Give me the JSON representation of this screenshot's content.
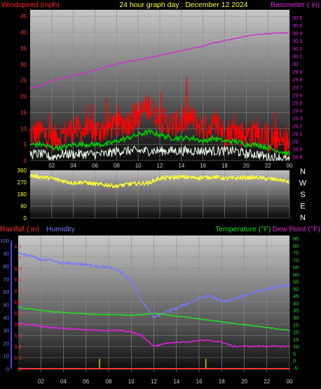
{
  "header": {
    "left_label": "Windspeed (mph)",
    "title": "24 hour graph day : December 12 2024",
    "right_label": "Barometer ( in)"
  },
  "colors": {
    "wind_speed": "#ff0000",
    "wind_avg": "#00cc00",
    "wind_low": "#f0fff0",
    "barometer": "#cc33cc",
    "direction": "#ffff33",
    "humidity": "#7777ff",
    "temperature": "#22dd22",
    "dewpoint": "#dd22dd",
    "rain": "#ff3333",
    "rain_tick": "#cccc00"
  },
  "chart_data": [
    {
      "type": "line",
      "name": "wind-barometer",
      "x_ticks": [
        "02",
        "04",
        "06",
        "08",
        "10",
        "12",
        "14",
        "16",
        "18",
        "20",
        "22",
        "00"
      ],
      "y_left_ticks": [
        "0",
        "5",
        "10",
        "15",
        "20",
        "25",
        "30",
        "35",
        "40",
        "45"
      ],
      "ylim_left": [
        0,
        47
      ],
      "y_right_ticks": [
        "28.8",
        "28.9",
        "29",
        "29.1",
        "29.2",
        "29.3",
        "29.4",
        "29.5",
        "29.6",
        "29.7",
        "29.8",
        "29.9",
        "30",
        "30.1",
        "30.2",
        "30.3",
        "30.4",
        "30.5",
        "30.6"
      ],
      "ylim_right": [
        28.75,
        30.7
      ],
      "x": [
        0,
        1,
        2,
        3,
        4,
        5,
        6,
        7,
        8,
        9,
        10,
        11,
        12,
        13,
        14,
        15,
        16,
        17,
        18,
        19,
        20,
        21,
        22,
        23,
        24
      ],
      "series": [
        {
          "key": "wind_speed",
          "axis": "left",
          "values": [
            8,
            9,
            7,
            8,
            10,
            9,
            9,
            10,
            11,
            12,
            14,
            17,
            13,
            11,
            12,
            13,
            10,
            11,
            9,
            9,
            8,
            9,
            7,
            6,
            5
          ]
        },
        {
          "key": "wind_avg",
          "axis": "left",
          "values": [
            5,
            5,
            4,
            4,
            5,
            5,
            5,
            5,
            6,
            7,
            8,
            9,
            8,
            7,
            7,
            7,
            6,
            7,
            6,
            6,
            5,
            5,
            4,
            3,
            2
          ]
        },
        {
          "key": "wind_low",
          "axis": "left",
          "values": [
            2,
            2,
            1,
            2,
            2,
            2,
            2,
            2,
            3,
            3,
            3,
            3,
            3,
            3,
            3,
            3,
            3,
            3,
            3,
            3,
            2,
            2,
            1,
            1,
            0
          ]
        },
        {
          "key": "barometer",
          "axis": "right",
          "values": [
            29.68,
            29.72,
            29.78,
            29.82,
            29.85,
            29.88,
            29.92,
            29.96,
            30.0,
            30.03,
            30.05,
            30.08,
            30.11,
            30.14,
            30.17,
            30.2,
            30.23,
            30.27,
            30.3,
            30.33,
            30.36,
            30.38,
            30.39,
            30.4,
            30.4
          ]
        }
      ]
    },
    {
      "type": "line",
      "name": "wind-direction",
      "side_labels": [
        "N",
        "W",
        "S",
        "E",
        "N"
      ],
      "y_ticks": [
        "0",
        "90",
        "180",
        "270",
        "360"
      ],
      "ylim": [
        0,
        360
      ],
      "x": [
        0,
        1,
        2,
        3,
        4,
        5,
        6,
        7,
        8,
        9,
        10,
        11,
        12,
        13,
        14,
        15,
        16,
        17,
        18,
        19,
        20,
        21,
        22,
        23,
        24
      ],
      "series": [
        {
          "key": "direction",
          "values": [
            320,
            310,
            300,
            280,
            265,
            270,
            255,
            250,
            240,
            255,
            260,
            265,
            300,
            305,
            310,
            305,
            305,
            310,
            300,
            300,
            305,
            305,
            295,
            290,
            270
          ]
        }
      ]
    },
    {
      "type": "line",
      "name": "rain-humidity-temperature",
      "legend": {
        "rainfall": "Rainfall (.in)",
        "humidity": "Humidity",
        "temperature": "Temperature (°F)",
        "dewpoint": "Dew Point (°F)"
      },
      "y_left_humidity_ticks": [
        "0",
        "10",
        "20",
        "30",
        "40",
        "50",
        "60",
        "70",
        "80",
        "90",
        "100"
      ],
      "y_left_rain_ticks": [
        "0",
        "0.1",
        "0.2",
        "0.3",
        "0.4",
        "0.5",
        "0.6",
        "0.7",
        "0.8",
        "0.9",
        "1",
        "1.1"
      ],
      "ylim_rain": [
        0,
        1.15
      ],
      "y_right_ticks": [
        "-5",
        "0",
        "5",
        "10",
        "15",
        "20",
        "25",
        "30",
        "35",
        "40",
        "45",
        "50",
        "55",
        "60",
        "65",
        "70",
        "75",
        "80",
        "85"
      ],
      "ylim_right": [
        -8,
        87
      ],
      "x": [
        0,
        1,
        2,
        3,
        4,
        5,
        6,
        7,
        8,
        9,
        10,
        11,
        12,
        13,
        14,
        15,
        16,
        17,
        18,
        19,
        20,
        21,
        22,
        23,
        24
      ],
      "series": [
        {
          "key": "humidity",
          "axis": "humidity",
          "values": [
            90,
            88,
            85,
            84,
            82,
            82,
            81,
            80,
            79,
            76,
            68,
            52,
            40,
            44,
            47,
            51,
            55,
            57,
            52,
            54,
            57,
            60,
            62,
            64,
            65
          ]
        },
        {
          "key": "temperature",
          "axis": "right",
          "values": [
            37,
            36,
            35,
            34,
            33.5,
            33,
            32.5,
            32,
            32,
            32,
            31.5,
            32,
            33,
            32,
            31,
            30,
            29,
            28,
            27,
            26,
            25,
            24,
            23,
            22,
            21
          ]
        },
        {
          "key": "dewpoint",
          "axis": "right",
          "values": [
            26,
            25,
            24,
            23,
            22.5,
            22,
            21.5,
            21,
            21,
            21,
            20,
            17,
            10,
            12,
            13,
            13,
            14,
            14,
            13,
            10,
            10,
            10,
            10,
            10,
            10
          ]
        }
      ],
      "rain_ticks_x": [
        7.2,
        16.6
      ]
    }
  ],
  "x_ticks_bottom": [
    "02",
    "04",
    "06",
    "08",
    "10",
    "12",
    "14",
    "16",
    "18",
    "20",
    "22",
    "00"
  ]
}
